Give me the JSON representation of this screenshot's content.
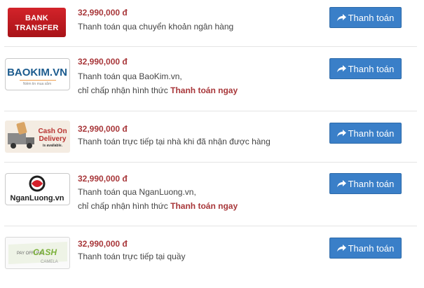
{
  "button_label": "Thanh toán",
  "colors": {
    "price": "#a8373a",
    "button": "#3a7fc8"
  },
  "methods": [
    {
      "logo_text": [
        "BANK",
        "TRANSFER"
      ],
      "price": "32,990,000 đ",
      "line1": "Thanh toán qua chuyển khoản ngân hàng",
      "line2_prefix": "",
      "line2_highlight": ""
    },
    {
      "logo_text": [
        "BAOKIM.VN",
        "Niềm tin mua sắm"
      ],
      "price": "32,990,000 đ",
      "line1": "Thanh toán qua BaoKim.vn,",
      "line2_prefix": "chỉ chấp nhận hình thức",
      "line2_highlight": "Thanh toán ngay"
    },
    {
      "logo_text": [
        "Cash On",
        "Delivery",
        "is available."
      ],
      "price": "32,990,000 đ",
      "line1": "Thanh toán trực tiếp tại nhà khi đã nhận được hàng",
      "line2_prefix": "",
      "line2_highlight": ""
    },
    {
      "logo_text": [
        "NganLuong.vn"
      ],
      "price": "32,990,000 đ",
      "line1": "Thanh toán qua NganLuong.vn,",
      "line2_prefix": "chỉ chấp nhận hình thức",
      "line2_highlight": "Thanh toán ngay"
    },
    {
      "logo_text": [
        "PAY OFFLINE",
        "CASH",
        "CAMELA"
      ],
      "price": "32,990,000 đ",
      "line1": "Thanh toán trực tiếp tại quầy",
      "line2_prefix": "",
      "line2_highlight": ""
    }
  ]
}
